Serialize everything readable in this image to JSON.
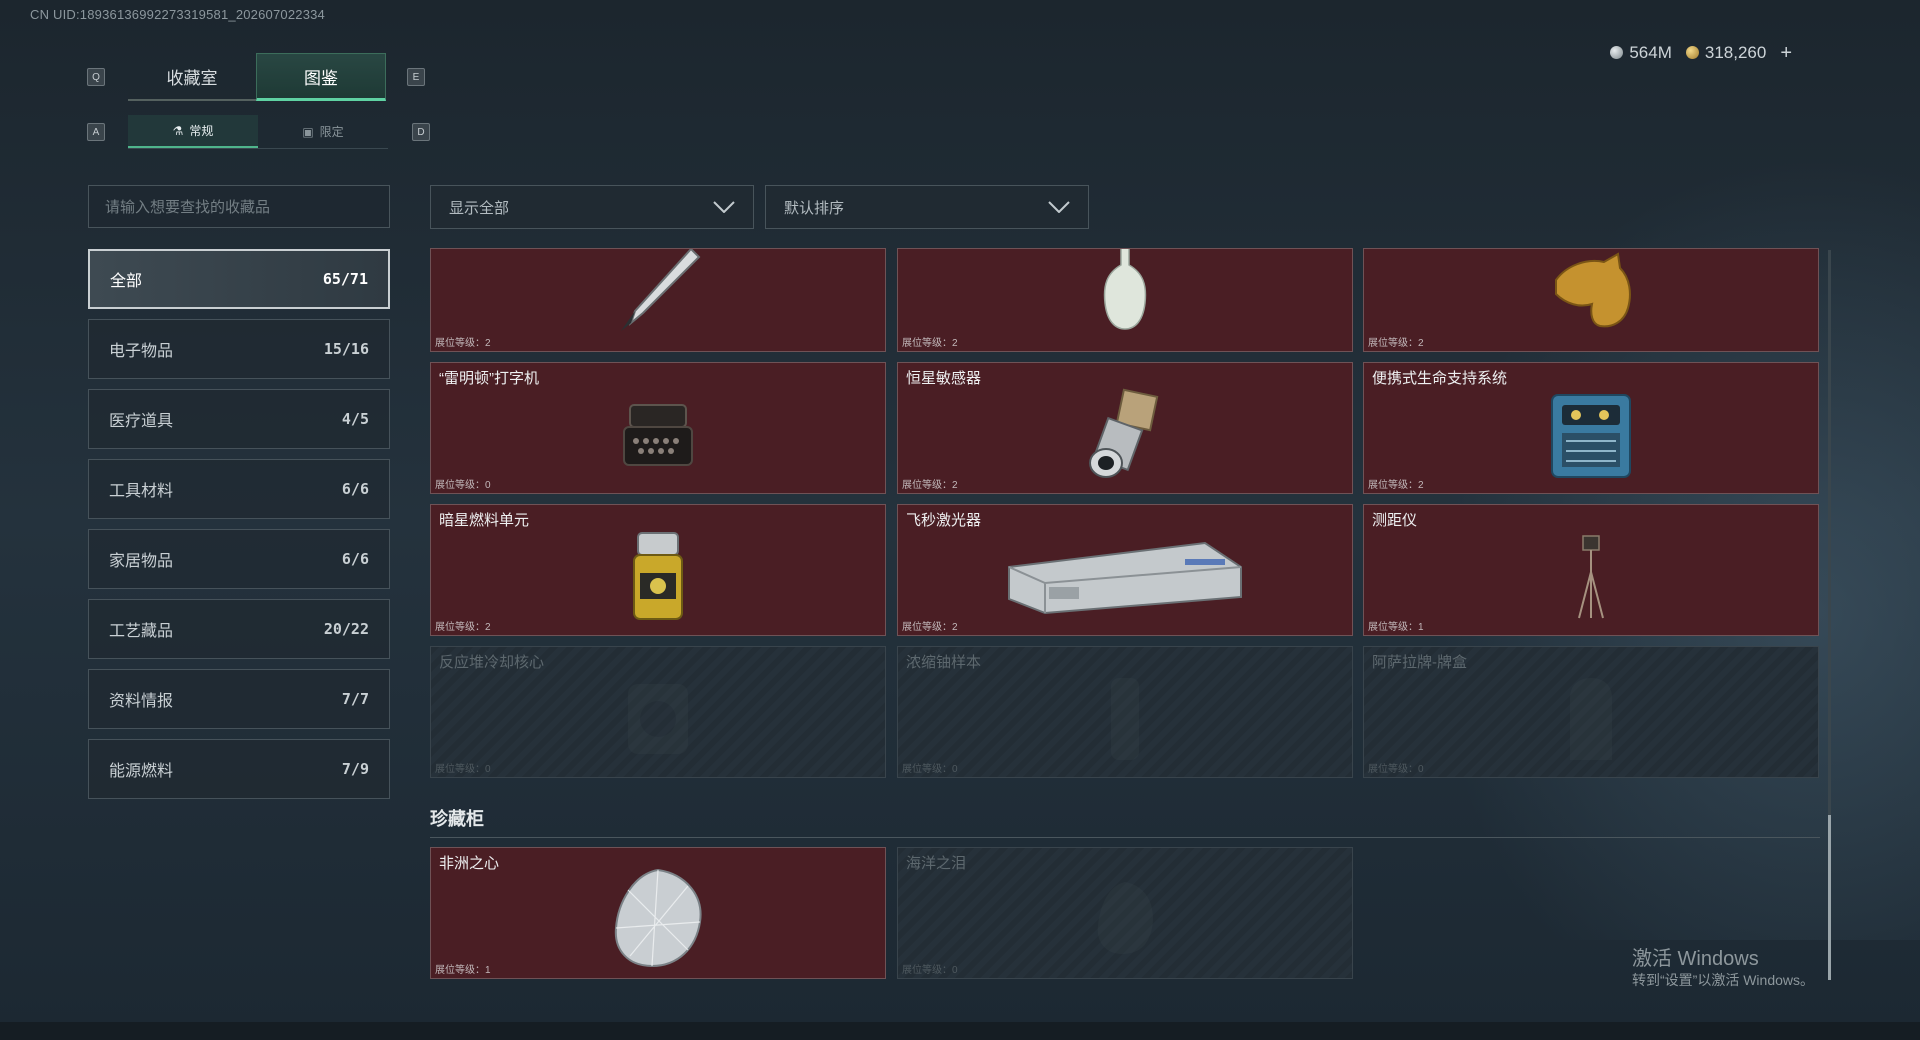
{
  "uid": "CN UID:18936136992273319581_202607022334",
  "keys": {
    "q": "Q",
    "e": "E",
    "a": "A",
    "d": "D"
  },
  "tabs": [
    {
      "label": "收藏室"
    },
    {
      "label": "图鉴"
    }
  ],
  "subtabs": [
    {
      "label": "常规"
    },
    {
      "label": "限定"
    }
  ],
  "currency": {
    "coins": "564M",
    "gold": "318,260",
    "add": "+"
  },
  "search": {
    "placeholder": "请输入想要查找的收藏品"
  },
  "filters": {
    "show": "显示全部",
    "sort": "默认排序"
  },
  "categories": [
    {
      "label": "全部",
      "count": "65/71"
    },
    {
      "label": "电子物品",
      "count": "15/16"
    },
    {
      "label": "医疗道具",
      "count": "4/5"
    },
    {
      "label": "工具材料",
      "count": "6/6"
    },
    {
      "label": "家居物品",
      "count": "6/6"
    },
    {
      "label": "工艺藏品",
      "count": "20/22"
    },
    {
      "label": "资料情报",
      "count": "7/7"
    },
    {
      "label": "能源燃料",
      "count": "7/9"
    }
  ],
  "items": [
    {
      "name": "",
      "level": "展位等级：2"
    },
    {
      "name": "",
      "level": "展位等级：2"
    },
    {
      "name": "",
      "level": "展位等级：2"
    },
    {
      "name": "“雷明顿”打字机",
      "level": "展位等级：0"
    },
    {
      "name": "恒星敏感器",
      "level": "展位等级：2"
    },
    {
      "name": "便携式生命支持系统",
      "level": "展位等级：2"
    },
    {
      "name": "暗星燃料单元",
      "level": "展位等级：2"
    },
    {
      "name": "飞秒激光器",
      "level": "展位等级：2"
    },
    {
      "name": "测距仪",
      "level": "展位等级：1"
    },
    {
      "name": "反应堆冷却核心",
      "level": "展位等级：0"
    },
    {
      "name": "浓缩铀样本",
      "level": "展位等级：0"
    },
    {
      "name": "阿萨拉牌-牌盒",
      "level": "展位等级：0"
    }
  ],
  "cabinet": {
    "title": "珍藏柜",
    "items": [
      {
        "name": "非洲之心",
        "level": "展位等级：1"
      },
      {
        "name": "海洋之泪",
        "level": "展位等级：0"
      }
    ]
  },
  "watermark": {
    "line1": "激活 Windows",
    "line2": "转到“设置”以激活 Windows。"
  }
}
